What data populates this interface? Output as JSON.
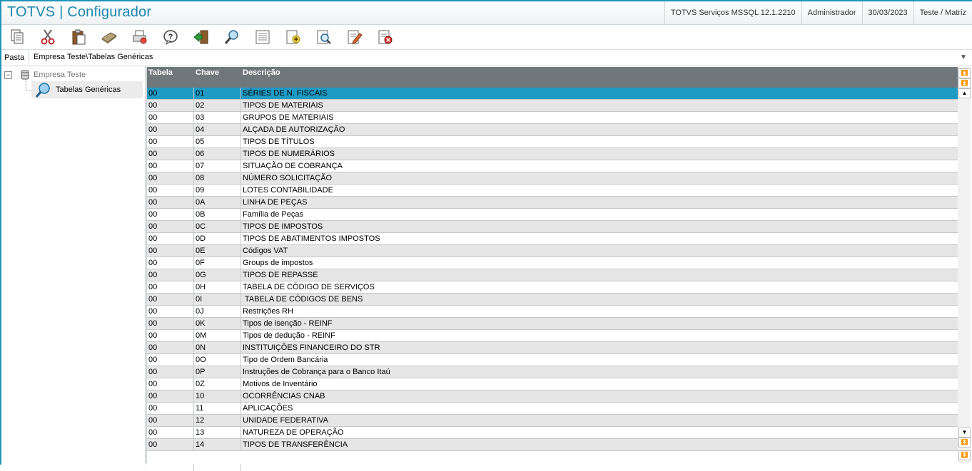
{
  "window": {
    "title": "TOTVS | Configurador",
    "status": [
      "TOTVS Serviços MSSQL 12.1.2210",
      "Administrador",
      "30/03/2023",
      "Teste / Matriz"
    ]
  },
  "toolbar": {
    "buttons": [
      {
        "icon": "copy-icon"
      },
      {
        "icon": "cut-icon"
      },
      {
        "icon": "paste-icon"
      },
      {
        "icon": "calculator-icon"
      },
      {
        "icon": "print-icon"
      },
      {
        "icon": "help-icon"
      },
      {
        "icon": "exit-icon"
      },
      {
        "icon": "search-icon"
      },
      {
        "icon": "view-icon"
      },
      {
        "icon": "add-icon"
      },
      {
        "icon": "preview-icon"
      },
      {
        "icon": "edit-icon"
      },
      {
        "icon": "delete-icon"
      }
    ]
  },
  "path": {
    "label": "Pasta",
    "value": "Empresa Teste\\Tabelas Genéricas"
  },
  "tree": {
    "root": "Empresa Teste",
    "child": "Tabelas Genéricas"
  },
  "grid": {
    "columns": [
      "Tabela",
      "Chave",
      "Descrição"
    ],
    "rows": [
      [
        "00",
        "01",
        "SÉRIES DE N. FISCAIS"
      ],
      [
        "00",
        "02",
        "TIPOS DE MATERIAIS"
      ],
      [
        "00",
        "03",
        "GRUPOS DE MATERIAIS"
      ],
      [
        "00",
        "04",
        "ALÇADA DE AUTORIZAÇÃO"
      ],
      [
        "00",
        "05",
        "TIPOS DE TÍTULOS"
      ],
      [
        "00",
        "06",
        "TIPOS DE NUMERÁRIOS"
      ],
      [
        "00",
        "07",
        "SITUAÇÃO DE COBRANÇA"
      ],
      [
        "00",
        "08",
        "NÚMERO SOLICITAÇÃO"
      ],
      [
        "00",
        "09",
        "LOTES CONTABILIDADE"
      ],
      [
        "00",
        "0A",
        "LINHA DE PEÇAS"
      ],
      [
        "00",
        "0B",
        "Família de Peças"
      ],
      [
        "00",
        "0C",
        "TIPOS DE IMPOSTOS"
      ],
      [
        "00",
        "0D",
        "TIPOS DE ABATIMENTOS IMPOSTOS"
      ],
      [
        "00",
        "0E",
        "Códigos VAT"
      ],
      [
        "00",
        "0F",
        "Groups de impostos"
      ],
      [
        "00",
        "0G",
        "TIPOS DE REPASSE"
      ],
      [
        "00",
        "0H",
        "TABELA DE CÓDIGO DE SERVIÇOS"
      ],
      [
        "00",
        "0I",
        " TABELA DE CÓDIGOS DE BENS"
      ],
      [
        "00",
        "0J",
        "Restrições RH"
      ],
      [
        "00",
        "0K",
        "Tipos de isenção - REINF"
      ],
      [
        "00",
        "0M",
        "Tipos de dedução - REINF"
      ],
      [
        "00",
        "0N",
        "INSTITUIÇÕES FINANCEIRO DO STR"
      ],
      [
        "00",
        "0O",
        "Tipo de Ordem Bancária"
      ],
      [
        "00",
        "0P",
        "Instruções de Cobrança para o Banco Itaú"
      ],
      [
        "00",
        "0Z",
        "Motivos de Inventário"
      ],
      [
        "00",
        "10",
        "OCORRÊNCIAS CNAB"
      ],
      [
        "00",
        "11",
        "APLICAÇÕES"
      ],
      [
        "00",
        "12",
        "UNIDADE FEDERATIVA"
      ],
      [
        "00",
        "13",
        "NATUREZA DE OPERAÇÃO"
      ],
      [
        "00",
        "14",
        "TIPOS DE TRANSFERÊNCIA"
      ]
    ],
    "selected_index": 0
  },
  "colors": {
    "accent": "#1c86b1",
    "selected_row": "#1f9ac4",
    "header_bg": "#6f777a"
  }
}
